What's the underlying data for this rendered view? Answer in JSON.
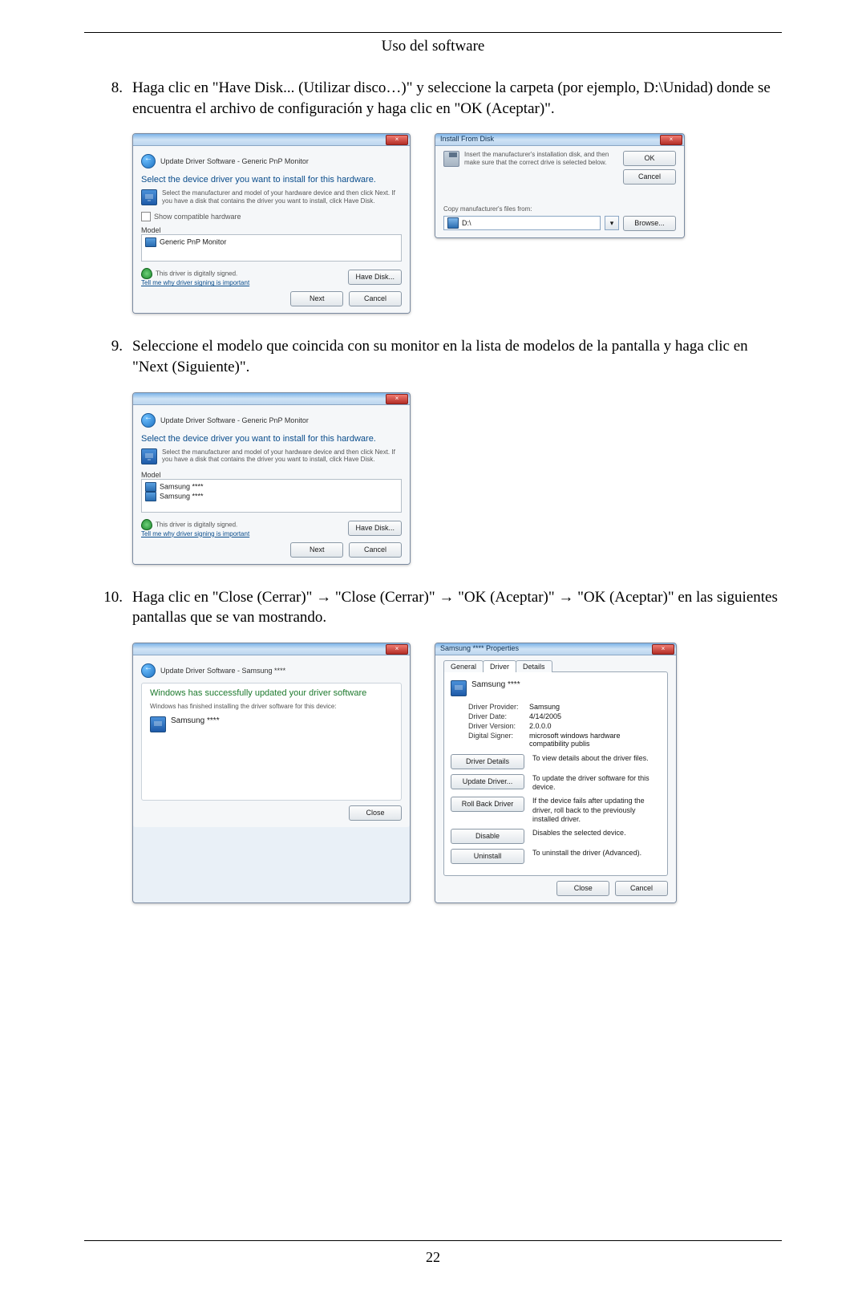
{
  "header": {
    "title": "Uso del software"
  },
  "page_number": "22",
  "steps": {
    "s8": {
      "num": "8.",
      "text": "Haga clic en \"Have Disk... (Utilizar disco…)\" y seleccione la carpeta (por ejemplo, D:\\Unidad) donde se encuentra el archivo de configuración y haga clic en \"OK (Aceptar)\"."
    },
    "s9": {
      "num": "9.",
      "text": "Seleccione el modelo que coincida con su monitor en la lista de modelos de la pantalla y haga clic en \"Next (Siguiente)\"."
    },
    "s10": {
      "num": "10.",
      "text": "Haga clic en \"Close (Cerrar)\" → \"Close (Cerrar)\" → \"OK (Aceptar)\" → \"OK (Aceptar)\" en las siguientes pantallas que se van mostrando."
    }
  },
  "dlg_select1": {
    "crumb": "Update Driver Software - Generic PnP Monitor",
    "heading": "Select the device driver you want to install for this hardware.",
    "helper": "Select the manufacturer and model of your hardware device and then click Next. If you have a disk that contains the driver you want to install, click Have Disk.",
    "show_compat": "Show compatible hardware",
    "model_label": "Model",
    "model_item": "Generic PnP Monitor",
    "signed": "This driver is digitally signed.",
    "tell_me": "Tell me why driver signing is important",
    "have_disk": "Have Disk...",
    "next": "Next",
    "cancel": "Cancel"
  },
  "dlg_install_disk": {
    "title": "Install From Disk",
    "msg": "Insert the manufacturer's installation disk, and then make sure that the correct drive is selected below.",
    "ok": "OK",
    "cancel": "Cancel",
    "copy_from": "Copy manufacturer's files from:",
    "field": "D:\\",
    "browse": "Browse..."
  },
  "dlg_select2": {
    "crumb": "Update Driver Software - Generic PnP Monitor",
    "heading": "Select the device driver you want to install for this hardware.",
    "helper": "Select the manufacturer and model of your hardware device and then click Next. If you have a disk that contains the driver you want to install, click Have Disk.",
    "model_label": "Model",
    "item1": "Samsung ****",
    "item2": "Samsung ****",
    "signed": "This driver is digitally signed.",
    "tell_me": "Tell me why driver signing is important",
    "have_disk": "Have Disk...",
    "next": "Next",
    "cancel": "Cancel"
  },
  "dlg_done": {
    "crumb": "Update Driver Software - Samsung ****",
    "heading": "Windows has successfully updated your driver software",
    "sub": "Windows has finished installing the driver software for this device:",
    "device": "Samsung ****",
    "close": "Close"
  },
  "dlg_props": {
    "title": "Samsung **** Properties",
    "tab_general": "General",
    "tab_driver": "Driver",
    "tab_details": "Details",
    "device": "Samsung ****",
    "provider_k": "Driver Provider:",
    "provider_v": "Samsung",
    "date_k": "Driver Date:",
    "date_v": "4/14/2005",
    "version_k": "Driver Version:",
    "version_v": "2.0.0.0",
    "signer_k": "Digital Signer:",
    "signer_v": "microsoft windows hardware compatibility publis",
    "btn_details": "Driver Details",
    "desc_details": "To view details about the driver files.",
    "btn_update": "Update Driver...",
    "desc_update": "To update the driver software for this device.",
    "btn_rollback": "Roll Back Driver",
    "desc_rollback": "If the device fails after updating the driver, roll back to the previously installed driver.",
    "btn_disable": "Disable",
    "desc_disable": "Disables the selected device.",
    "btn_uninstall": "Uninstall",
    "desc_uninstall": "To uninstall the driver (Advanced).",
    "close": "Close",
    "cancel": "Cancel"
  }
}
